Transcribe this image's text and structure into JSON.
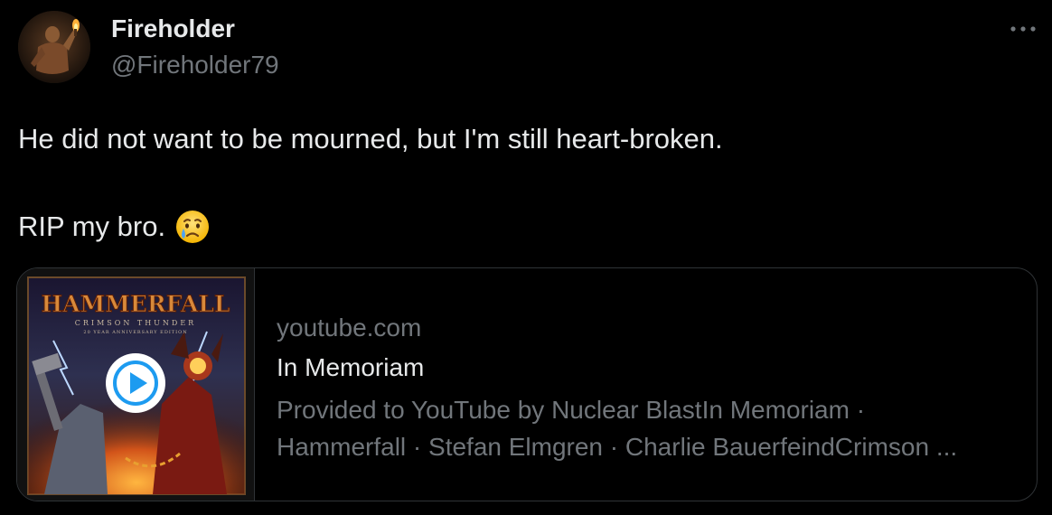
{
  "author": {
    "display_name": "Fireholder",
    "handle": "@Fireholder79"
  },
  "tweet": {
    "line1": "He did not want to be mourned, but I'm still heart-broken.",
    "line2": "RIP my bro.",
    "emoji": "crying-face"
  },
  "card": {
    "domain": "youtube.com",
    "title": "In Memoriam",
    "description_line1": "Provided to YouTube by Nuclear BlastIn Memoriam ·",
    "description_line2": "Hammerfall · Stefan Elmgren · Charlie BauerfeindCrimson ...",
    "thumbnail": {
      "band_logo": "HAMMERFALL",
      "album": "CRIMSON THUNDER",
      "edition": "20 YEAR ANNIVERSARY EDITION"
    }
  },
  "icons": {
    "more": "more-dots-icon",
    "play": "play-icon"
  },
  "colors": {
    "background": "#000000",
    "text": "#e7e9ea",
    "muted": "#71767b",
    "border": "#2f3336",
    "play_blue": "#1d9bf0"
  }
}
